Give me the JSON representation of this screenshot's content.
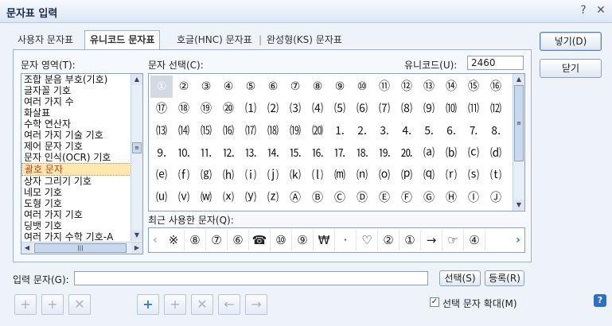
{
  "window": {
    "title": "문자표 입력",
    "help_btn": "?",
    "close_btn": "✕"
  },
  "tabs": [
    {
      "label": "사용자 문자표"
    },
    {
      "label": "유니코드 문자표"
    },
    {
      "label": "호글(HNC) 문자표"
    },
    {
      "label": "완성형(KS) 문자표"
    }
  ],
  "tab_separator": "|",
  "area": {
    "label": "문자 영역(T):",
    "items": [
      "조합 분음 부호(기호)",
      "글자꼴 기호",
      "여러 가지 수",
      "화살표",
      "수학 연산자",
      "여러 가지 기술 기호",
      "제어 문자 기호",
      "문자 인식(OCR) 기호",
      "괄호 문자",
      "상자 그리기 기호",
      "네모 기호",
      "도형 기호",
      "여러 가지 기호",
      "딩뱃 기호",
      "여러 가지 수학 기호-A"
    ],
    "selected": "괄호 문자"
  },
  "grid": {
    "label": "문자 선택(C):",
    "unicode_label": "유니코드(U):",
    "unicode_value": "2460",
    "chars": [
      "①",
      "②",
      "③",
      "④",
      "⑤",
      "⑥",
      "⑦",
      "⑧",
      "⑨",
      "⑩",
      "⑪",
      "⑫",
      "⑬",
      "⑭",
      "⑮",
      "⑯",
      "⑰",
      "⑱",
      "⑲",
      "⑳",
      "⑴",
      "⑵",
      "⑶",
      "⑷",
      "⑸",
      "⑹",
      "⑺",
      "⑻",
      "⑼",
      "⑽",
      "⑾",
      "⑿",
      "⒀",
      "⒁",
      "⒂",
      "⒃",
      "⒄",
      "⒅",
      "⒆",
      "⒇",
      "⒈",
      "⒉",
      "⒊",
      "⒋",
      "⒌",
      "⒍",
      "⒎",
      "⒏",
      "⒐",
      "⒑",
      "⒒",
      "⒓",
      "⒔",
      "⒕",
      "⒖",
      "⒗",
      "⒘",
      "⒙",
      "⒚",
      "⒛",
      "⒜",
      "⒝",
      "⒞",
      "⒟",
      "⒠",
      "⒡",
      "⒢",
      "⒣",
      "⒤",
      "⒥",
      "⒦",
      "⒧",
      "⒨",
      "⒩",
      "⒪",
      "⒫",
      "⒬",
      "⒭",
      "⒮",
      "⒯",
      "⒰",
      "⒱",
      "⒲",
      "⒳",
      "⒴",
      "⒵",
      "Ⓐ",
      "Ⓑ",
      "Ⓒ",
      "Ⓓ",
      "Ⓔ",
      "Ⓕ",
      "Ⓖ",
      "Ⓗ",
      "Ⓘ",
      "Ⓙ"
    ]
  },
  "recent": {
    "label": "최근 사용한 문자(Q):",
    "chars": [
      "※",
      "⑧",
      "⑦",
      "⑥",
      "☎",
      "⑩",
      "⑨",
      "₩",
      "·",
      "♡",
      "②",
      "①",
      "→",
      "☞",
      "④"
    ]
  },
  "input": {
    "label": "입력 문자(G):",
    "value": ""
  },
  "buttons": {
    "insert": "넣기(D)",
    "close": "닫기",
    "select": "선택(S)",
    "register": "등록(R)"
  },
  "toolbar": {
    "add_to_user": "+",
    "edit": "+",
    "delete": "✕",
    "prev": "←",
    "next": "→",
    "delete_all": "✕"
  },
  "enlarge": {
    "label": "선택 문자 확대(M)",
    "checked": "✓"
  },
  "help": "?"
}
